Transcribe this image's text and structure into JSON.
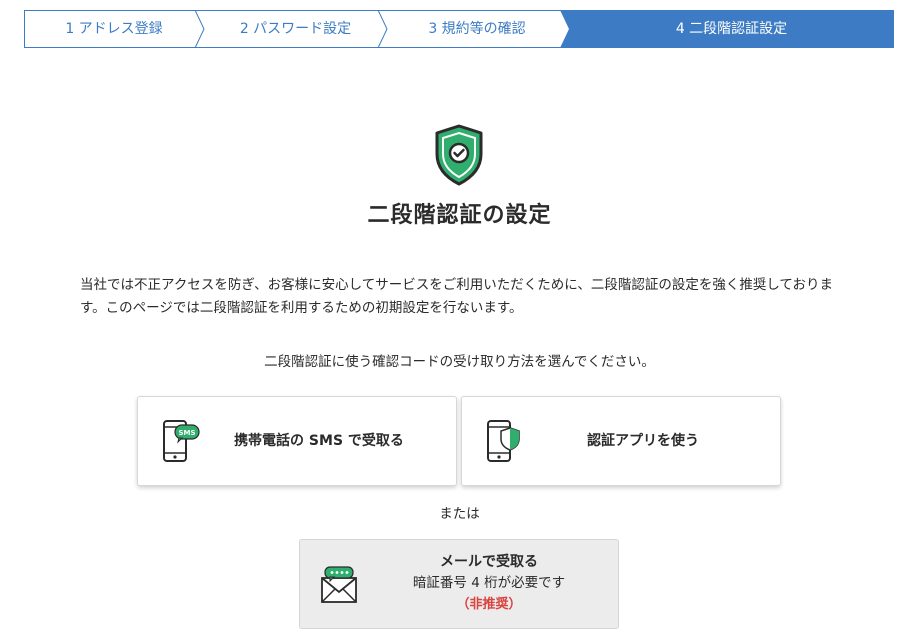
{
  "stepper": {
    "steps": [
      {
        "label": "1 アドレス登録"
      },
      {
        "label": "2 パスワード設定"
      },
      {
        "label": "3 規約等の確認"
      },
      {
        "label": "4 二段階認証設定"
      }
    ],
    "current_step": 4,
    "accent_color": "#3d7cc4"
  },
  "header": {
    "icon": "shield-check-icon",
    "title": "二段階認証の設定"
  },
  "main": {
    "intro": "当社では不正アクセスを防ぎ、お客様に安心してサービスをご利用いただくために、二段階認証の設定を強く推奨しております。このページでは二段階認証を利用するための初期設定を行ないます。",
    "instruction": "二段階認証に使う確認コードの受け取り方法を選んでください。",
    "options": [
      {
        "label": "携帯電話の SMS で受取る",
        "icon": "phone-sms-icon"
      },
      {
        "label": "認証アプリを使う",
        "icon": "phone-shield-icon"
      }
    ],
    "or_text": "または",
    "email_option": {
      "icon": "envelope-icon",
      "title": "メールで受取る",
      "subtitle": "暗証番号 4 桁が必要です",
      "warning": "（非推奨）",
      "warning_color": "#d9443f"
    }
  },
  "colors": {
    "brand_green": "#2fae6e",
    "text": "#2b2b2b"
  }
}
